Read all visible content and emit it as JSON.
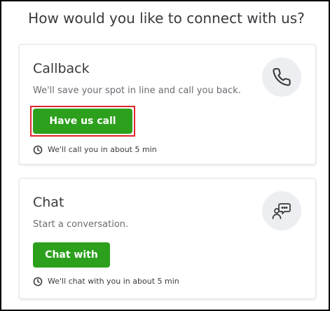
{
  "heading": "How would you like to connect with us?",
  "callback": {
    "title": "Callback",
    "description": "We'll save your spot in line and call you back.",
    "button_label": "Have us call you",
    "eta": "We'll call you in about 5 min",
    "icon": "phone-icon"
  },
  "chat": {
    "title": "Chat",
    "description": "Start a conversation.",
    "button_label": "Chat with us",
    "eta": "We'll chat with you in about 5 min",
    "icon": "chat-agent-icon"
  },
  "colors": {
    "primary_button": "#2ca01c",
    "highlight": "#e0242b",
    "icon_circle": "#eceef1",
    "text": "#393a3d"
  }
}
